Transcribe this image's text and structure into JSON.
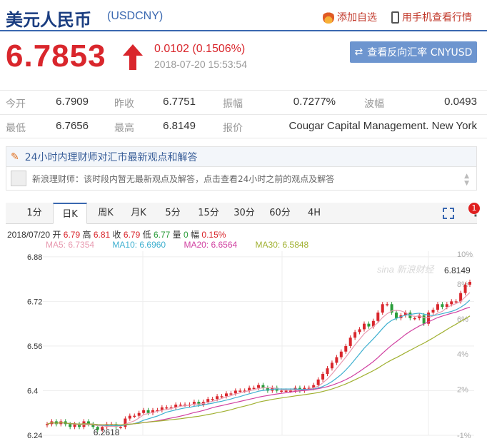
{
  "header": {
    "title": "美元人民币",
    "code": "(USDCNY)",
    "fav_label": "添加自选",
    "mobile_label": "用手机查看行情"
  },
  "quote": {
    "price": "6.7853",
    "change": "0.0102 (0.1506%)",
    "timestamp": "2018-07-20 15:53:54",
    "reverse_label": "查看反向汇率 CNYUSD"
  },
  "stats": {
    "rows": [
      [
        {
          "label": "今开",
          "value": "6.7909"
        },
        {
          "label": "昨收",
          "value": "6.7751"
        },
        {
          "label": "振幅",
          "value": "0.7277%"
        },
        {
          "label": "波幅",
          "value": "0.0493"
        }
      ],
      [
        {
          "label": "最低",
          "value": "6.7656"
        },
        {
          "label": "最高",
          "value": "6.8149"
        },
        {
          "label": "报价",
          "value": "Cougar Capital Management. New York"
        }
      ]
    ]
  },
  "views": {
    "heading": "24小时内理财师对汇市最新观点和解答",
    "message": "新浪理财师：该时段内暂无最新观点及解答，点击查看24小时之前的观点及解答"
  },
  "tabs": [
    "1分",
    "日K",
    "周K",
    "月K",
    "5分",
    "15分",
    "30分",
    "60分",
    "4H"
  ],
  "active_tab": 1,
  "badge": "1",
  "ohlc_info": {
    "date": "2018/07/20",
    "open_label": "开",
    "open": "6.79",
    "high_label": "高",
    "high": "6.81",
    "close_label": "收",
    "close": "6.79",
    "low_label": "低",
    "low": "6.77",
    "vol_label": "量",
    "vol": "0",
    "amp_label": "幅",
    "amp": "0.15%"
  },
  "ma_info": [
    {
      "label": "MA5: 6.7354",
      "color": "#e89ab0"
    },
    {
      "label": "MA10: 6.6960",
      "color": "#3fb0d0"
    },
    {
      "label": "MA20: 6.6564",
      "color": "#d040a0"
    },
    {
      "label": "MA30: 6.5848",
      "color": "#a0b030"
    }
  ],
  "colors": {
    "up": "#d9262c",
    "down": "#2a9d3a",
    "brand": "#3a68b0"
  },
  "chart_data": {
    "type": "candlestick",
    "watermark": "sina 新浪财经",
    "y_ticks": [
      6.88,
      6.72,
      6.56,
      6.4,
      6.24
    ],
    "ylim": [
      6.24,
      6.9
    ],
    "pct_ticks": [
      "10%",
      "8%",
      "6%",
      "4%",
      "2%",
      "-1%"
    ],
    "pct_values": [
      10,
      8,
      6,
      4,
      2,
      -1
    ],
    "min_label": "6.2618",
    "max_label": "6.8149",
    "closes": [
      6.28,
      6.29,
      6.28,
      6.29,
      6.28,
      6.27,
      6.28,
      6.27,
      6.29,
      6.28,
      6.27,
      6.26,
      6.27,
      6.28,
      6.28,
      6.27,
      6.27,
      6.3,
      6.31,
      6.31,
      6.32,
      6.33,
      6.32,
      6.33,
      6.33,
      6.34,
      6.34,
      6.34,
      6.35,
      6.35,
      6.35,
      6.35,
      6.36,
      6.35,
      6.36,
      6.37,
      6.37,
      6.38,
      6.38,
      6.39,
      6.39,
      6.4,
      6.4,
      6.4,
      6.41,
      6.41,
      6.42,
      6.41,
      6.4,
      6.41,
      6.4,
      6.4,
      6.4,
      6.4,
      6.41,
      6.4,
      6.41,
      6.41,
      6.42,
      6.44,
      6.46,
      6.48,
      6.5,
      6.52,
      6.54,
      6.56,
      6.59,
      6.61,
      6.62,
      6.64,
      6.63,
      6.65,
      6.68,
      6.71,
      6.71,
      6.68,
      6.66,
      6.67,
      6.68,
      6.66,
      6.66,
      6.67,
      6.64,
      6.68,
      6.69,
      6.71,
      6.7,
      6.71,
      6.72,
      6.72,
      6.75,
      6.78,
      6.79
    ],
    "ma5_last": 6.7354,
    "ma10_last": 6.696,
    "ma20_last": 6.6564,
    "ma30_last": 6.5848
  }
}
